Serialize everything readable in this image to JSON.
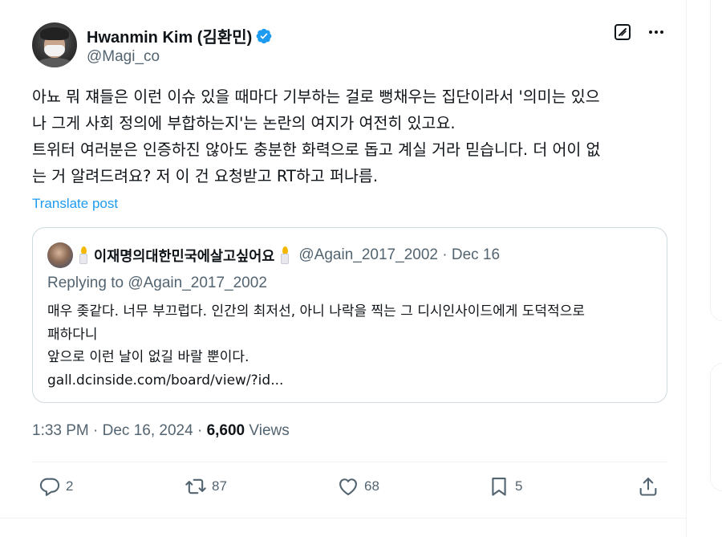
{
  "author": {
    "display_name": "Hwanmin Kim (김환민)",
    "handle": "@Magi_co",
    "verified": true
  },
  "icons": {
    "grok": "grok-icon",
    "more": "more-icon",
    "verified": "verified-badge-icon",
    "reply": "reply-icon",
    "retweet": "retweet-icon",
    "like": "like-icon",
    "bookmark": "bookmark-icon",
    "share": "share-icon"
  },
  "tweet": {
    "text": "아뇨 뭐 쟤들은 이런 이슈 있을 때마다 기부하는 걸로 뻥채우는 집단이라서 '의미는 있으\n나 그게 사회 정의에 부합하는지'는 논란의 여지가 여전히 있고요.\n트위터 여러분은 인증하진 않아도 충분한 화력으로 돕고 계실 거라 믿습니다. 더 어이 없\n는 거 알려드려요? 저 이 건 요청받고 RT하고 퍼나름.",
    "translate_label": "Translate post"
  },
  "quote": {
    "name": "이재명의대한민국에살고싶어요",
    "handle_date": "@Again_2017_2002 · Dec 16",
    "replying_to": "Replying to @Again_2017_2002",
    "lines": [
      "매우 좆같다. 너무 부끄럽다. 인간의 최저선, 아니 나락을 찍는 그 디시인사이드에게 도덕적으로",
      "패하다니",
      "앞으로 이런 날이 없길 바랄 뿐이다.",
      "gall.dcinside.com/board/view/?id..."
    ]
  },
  "meta": {
    "time_date": "1:33 PM · Dec 16, 2024 · ",
    "views_count": "6,600",
    "views_label": " Views"
  },
  "actions": {
    "replies": "2",
    "retweets": "87",
    "likes": "68",
    "bookmarks": "5"
  },
  "colors": {
    "accent": "#1d9bf0",
    "text": "#0f1419",
    "secondary": "#536471",
    "border": "#cfd9de"
  }
}
